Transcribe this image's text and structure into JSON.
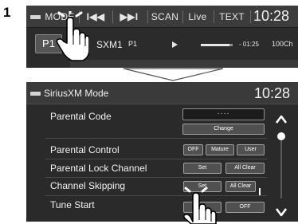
{
  "step_number": "1",
  "source_screen": {
    "buttons": {
      "mode": "MODE",
      "prev": "I◀◀",
      "next": "▶▶I",
      "scan": "SCAN",
      "live": "Live",
      "text": "TEXT"
    },
    "clock": "10:28",
    "preset": "P1",
    "channel_name": "SXM1",
    "channel_preset": "P1",
    "elapsed": "- 01:25",
    "channel_number": "100Ch",
    "progress": 0.9
  },
  "mode_screen": {
    "title": "SiriusXM Mode",
    "clock": "10:28",
    "rows": {
      "parental_code": {
        "label": "Parental Code",
        "value": "····",
        "change_label": "Change"
      },
      "parental_control": {
        "label": "Parental Control",
        "options": [
          "OFF",
          "Mature",
          "User"
        ]
      },
      "parental_lock": {
        "label": "Parental Lock Channel",
        "set_label": "Set",
        "clear_label": "All Clear"
      },
      "channel_skipping": {
        "label": "Channel Skipping",
        "set_label": "Set",
        "clear_label": "All Clear"
      },
      "tune_start": {
        "label": "Tune Start",
        "off_label": "OFF"
      }
    }
  },
  "colors": {
    "panel_bg": "#2a2a2a",
    "bar_bg": "#3c3c3c",
    "text": "#f2f2f2",
    "button_border": "#a0a0a0"
  }
}
